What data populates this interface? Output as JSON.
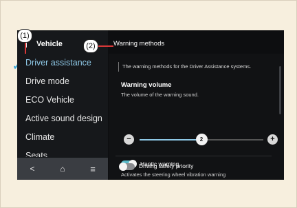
{
  "callouts": {
    "one": "(1)",
    "two": "(2)"
  },
  "sidebar": {
    "title": "Vehicle",
    "items": [
      {
        "label": "Driver assistance",
        "active": true
      },
      {
        "label": "Drive mode"
      },
      {
        "label": "ECO Vehicle"
      },
      {
        "label": "Active sound design"
      },
      {
        "label": "Climate"
      },
      {
        "label": "Seats"
      }
    ],
    "nav_icons": [
      "back-icon",
      "home-icon",
      "menu-icon"
    ],
    "nav_glyphs": [
      "<",
      "⌂",
      "≡"
    ]
  },
  "header": {
    "title": "Warning methods"
  },
  "panel": {
    "description": "The warning methods for the Driver Assistance systems.",
    "warning_volume": {
      "title": "Warning volume",
      "subtitle": "The volume of the warning sound.",
      "value": "2",
      "level_fraction": 0.5,
      "minus": "−",
      "plus": "+"
    },
    "haptic": {
      "label": "Haptic warning",
      "description": "Activates the steering wheel vibration warning",
      "on": true
    },
    "driving_safety": {
      "label": "Driving safety priority",
      "on": false
    }
  },
  "colors": {
    "accent": "#8ec8e6",
    "toggle_on": "#57b8c8",
    "toggle_off": "#8a8c90",
    "check": "#3fa9d8",
    "callout_line": "#d93838"
  }
}
